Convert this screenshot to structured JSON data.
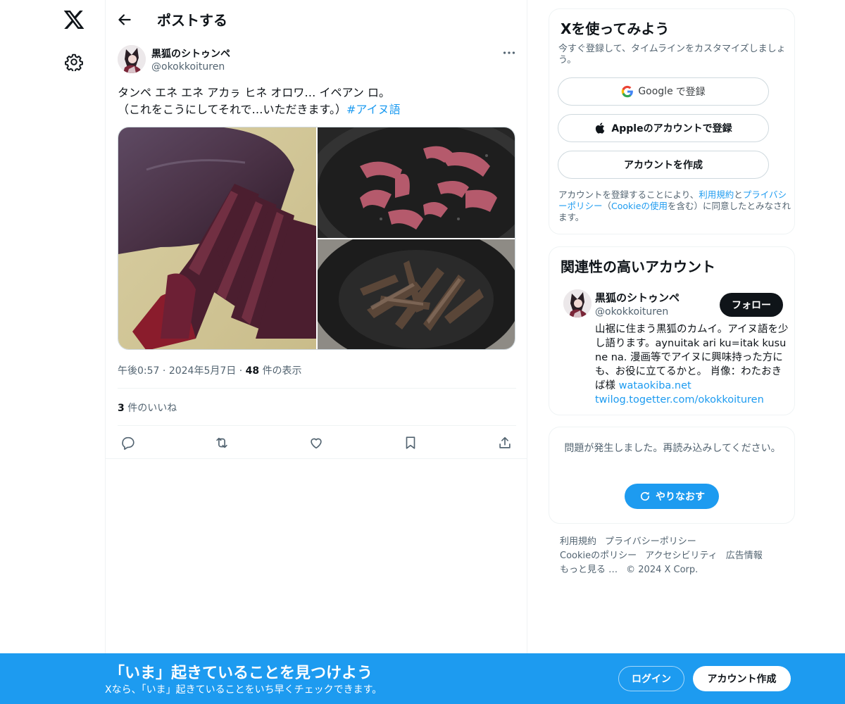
{
  "nav": {
    "logo_icon": "x-logo-icon",
    "settings_icon": "gear-icon"
  },
  "header": {
    "title": "ポストする",
    "back_icon": "arrow-left-icon"
  },
  "post": {
    "author_name": "黒狐のシトゥンペ",
    "author_handle": "@okokkoituren",
    "text_line1": "タンペ エネ エネ アカㇻ ヒネ オロワ… イペアン ロ。",
    "text_line2_plain": "（これをこうにしてそれで…いただきます。）",
    "hashtag": "#アイヌ語",
    "time": "午後0:57",
    "date": "2024年5月7日",
    "views_count": "48",
    "views_label": "件の表示",
    "likes_count": "3",
    "likes_label": "件のいいね",
    "separator": "·"
  },
  "signup": {
    "title": "Xを使ってみよう",
    "subtitle": "今すぐ登録して、タイムラインをカスタマイズしましょう。",
    "google_brand": "Google",
    "google_suffix": "で登録",
    "apple_label": "Appleのアカウントで登録",
    "create_label": "アカウントを作成",
    "legal_prefix": "アカウントを登録することにより、",
    "legal_terms": "利用規約",
    "legal_and": "と",
    "legal_privacy": "プライバシーポリシー",
    "legal_paren_open": "（",
    "legal_cookie": "Cookieの使用",
    "legal_suffix": "を含む）に同意したとみなされます。"
  },
  "recommend": {
    "title": "関連性の高いアカウント",
    "name": "黒狐のシトゥンペ",
    "handle": "@okokkoituren",
    "follow_label": "フォロー",
    "bio": "山裾に住まう黒狐のカムイ。アイヌ語を少し語ります。aynuitak ari ku=itak kusu ne na. 漫画等でアイヌに興味持った方にも、お役に立てるかと。 肖像：わたおきば様 ",
    "bio_link1": "wataokiba.net",
    "bio_link2": "twilog.togetter.com/okokkoituren"
  },
  "error": {
    "message": "問題が発生しました。再読み込みしてください。",
    "retry_label": "やりなおす"
  },
  "footer": {
    "terms": "利用規約",
    "privacy": "プライバシーポリシー",
    "cookie": "Cookieのポリシー",
    "accessibility": "アクセシビリティ",
    "ads": "広告情報",
    "more": "もっと見る …",
    "copyright": "© 2024 X Corp."
  },
  "banner": {
    "title": "「いま」起きていることを見つけよう",
    "subtitle": "Xなら、「いま」起きていることをいち早くチェックできます。",
    "login_label": "ログイン",
    "create_label": "アカウント作成"
  },
  "colors": {
    "accent": "#1d9bf0",
    "text": "#0f1419",
    "muted": "#536471"
  }
}
